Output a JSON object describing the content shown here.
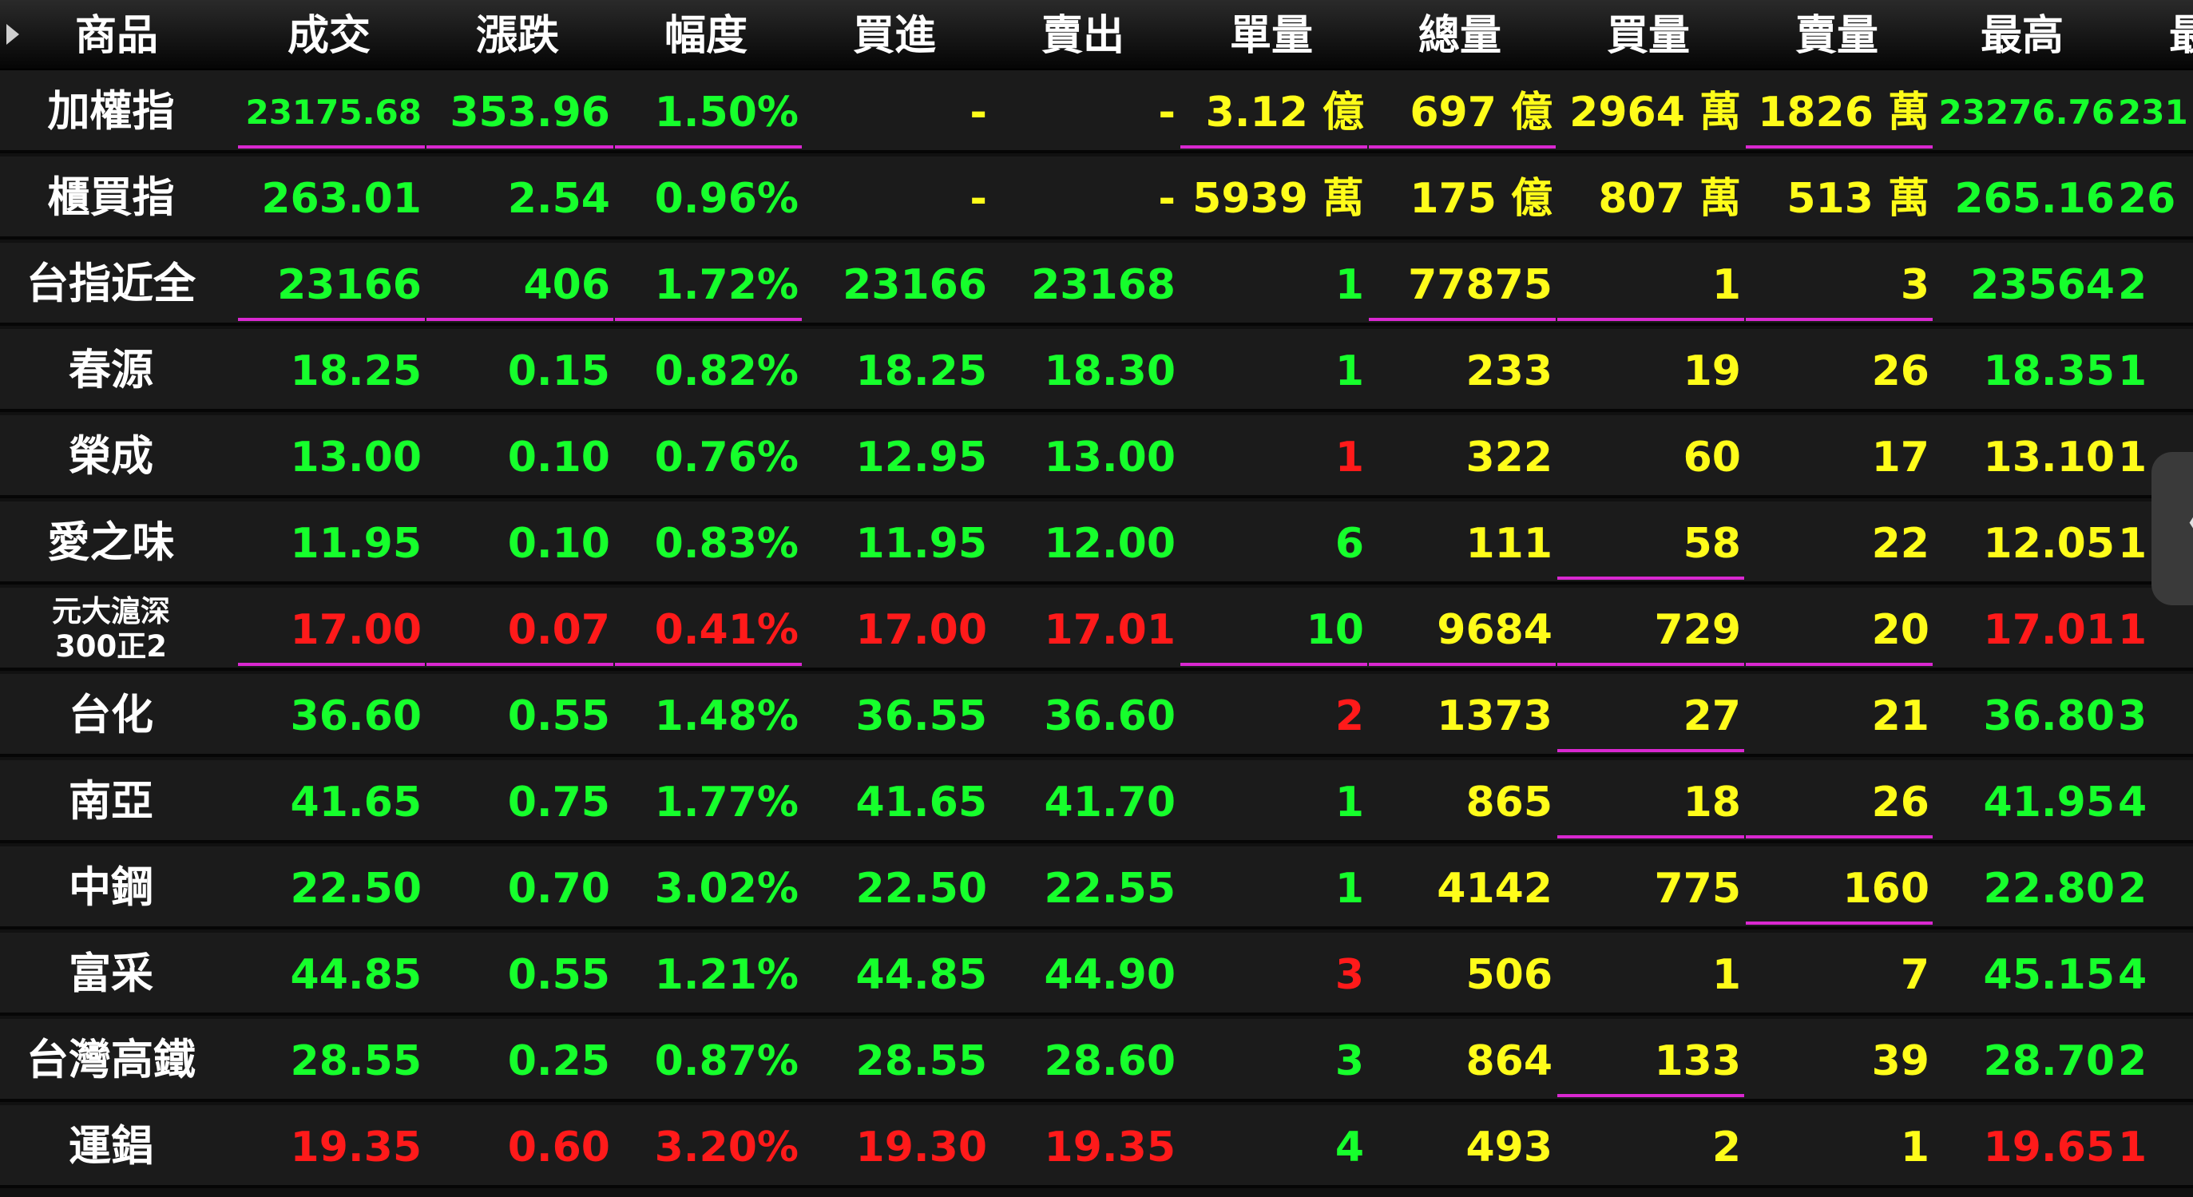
{
  "header": {
    "columns": [
      "商品",
      "成交",
      "漲跌",
      "幅度",
      "買進",
      "賣出",
      "單量",
      "總量",
      "買量",
      "賣量",
      "最高",
      "最"
    ]
  },
  "colors": {
    "up": "#16ff2c",
    "down": "#ff1a1a",
    "volume": "#fffc1a",
    "underline": "#d928d0"
  },
  "rows": [
    {
      "name": "加權指",
      "cells": [
        "23175.68",
        "353.96",
        "1.50%",
        "-",
        "-",
        "3.12 億",
        "697 億",
        "2964 萬",
        "1826 萬",
        "23276.76",
        "231"
      ]
    },
    {
      "name": "櫃買指",
      "cells": [
        "263.01",
        "2.54",
        "0.96%",
        "-",
        "-",
        "5939 萬",
        "175 億",
        "807 萬",
        "513 萬",
        "265.16",
        "26"
      ]
    },
    {
      "name": "台指近全",
      "cells": [
        "23166",
        "406",
        "1.72%",
        "23166",
        "23168",
        "1",
        "77875",
        "1",
        "3",
        "23564",
        "2"
      ]
    },
    {
      "name": "春源",
      "cells": [
        "18.25",
        "0.15",
        "0.82%",
        "18.25",
        "18.30",
        "1",
        "233",
        "19",
        "26",
        "18.35",
        "1"
      ]
    },
    {
      "name": "榮成",
      "cells": [
        "13.00",
        "0.10",
        "0.76%",
        "12.95",
        "13.00",
        "1",
        "322",
        "60",
        "17",
        "13.10",
        "1"
      ]
    },
    {
      "name": "愛之味",
      "cells": [
        "11.95",
        "0.10",
        "0.83%",
        "11.95",
        "12.00",
        "6",
        "111",
        "58",
        "22",
        "12.05",
        "1"
      ]
    },
    {
      "name1": "元大滬深",
      "name2": "300正2",
      "cells": [
        "17.00",
        "0.07",
        "0.41%",
        "17.00",
        "17.01",
        "10",
        "9684",
        "729",
        "20",
        "17.01",
        "1"
      ]
    },
    {
      "name": "台化",
      "cells": [
        "36.60",
        "0.55",
        "1.48%",
        "36.55",
        "36.60",
        "2",
        "1373",
        "27",
        "21",
        "36.80",
        "3"
      ]
    },
    {
      "name": "南亞",
      "cells": [
        "41.65",
        "0.75",
        "1.77%",
        "41.65",
        "41.70",
        "1",
        "865",
        "18",
        "26",
        "41.95",
        "4"
      ]
    },
    {
      "name": "中鋼",
      "cells": [
        "22.50",
        "0.70",
        "3.02%",
        "22.50",
        "22.55",
        "1",
        "4142",
        "775",
        "160",
        "22.80",
        "2"
      ]
    },
    {
      "name": "富采",
      "cells": [
        "44.85",
        "0.55",
        "1.21%",
        "44.85",
        "44.90",
        "3",
        "506",
        "1",
        "7",
        "45.15",
        "4"
      ]
    },
    {
      "name": "台灣高鐵",
      "cells": [
        "28.55",
        "0.25",
        "0.87%",
        "28.55",
        "28.60",
        "3",
        "864",
        "133",
        "39",
        "28.70",
        "2"
      ]
    },
    {
      "name": "運錩",
      "cells": [
        "19.35",
        "0.60",
        "3.20%",
        "19.30",
        "19.35",
        "4",
        "493",
        "2",
        "1",
        "19.65",
        "1"
      ]
    }
  ],
  "side_tab": {
    "icon": "chevron-left-icon",
    "glyph": "〈"
  }
}
